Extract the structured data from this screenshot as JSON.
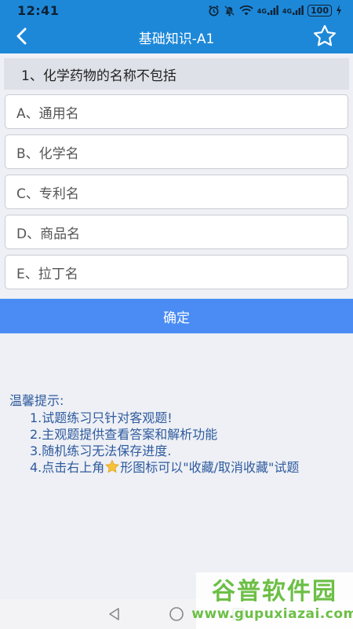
{
  "status_bar": {
    "time": "12:41",
    "signal1_label": "4G",
    "signal2_label": "4G",
    "battery": "100"
  },
  "header": {
    "title": "基础知识-A1"
  },
  "question": {
    "text": "1、化学药物的名称不包括"
  },
  "options": [
    {
      "label": "A、通用名"
    },
    {
      "label": "B、化学名"
    },
    {
      "label": "C、专利名"
    },
    {
      "label": "D、商品名"
    },
    {
      "label": "E、拉丁名"
    }
  ],
  "confirm_label": "确定",
  "tips": {
    "title": "温馨提示:",
    "items": [
      "1.试题练习只针对客观题!",
      "2.主观题提供查看答案和解析功能",
      "3.随机练习无法保存进度.",
      "4.点击右上角"
    ],
    "item4_suffix": "形图标可以\"收藏/取消收藏\"试题"
  },
  "watermark": {
    "main": "谷普软件园",
    "url": "www.gupuxiazai.com"
  },
  "colors": {
    "header_bg": "#1e88d8",
    "confirm_bg": "#4a8cf4",
    "tips_text": "#2e5a9e",
    "watermark": "#6cbf45"
  }
}
